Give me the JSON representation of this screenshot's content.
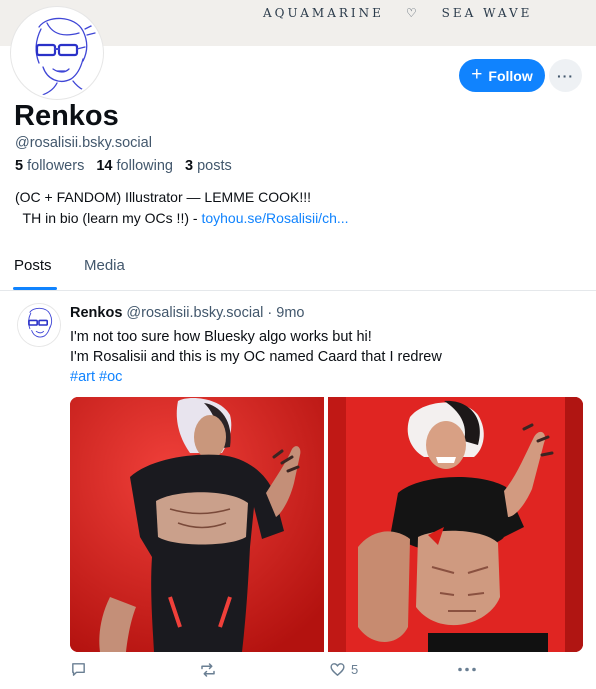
{
  "banner": {
    "left": "AQUAMARINE",
    "right": "SEA WAVE",
    "separator_icon": "heart-outline-icon"
  },
  "profile": {
    "display_name": "Renkos",
    "handle": "@rosalisii.bsky.social",
    "followers_count": "5",
    "followers_label": "followers",
    "following_count": "14",
    "following_label": "following",
    "posts_count": "3",
    "posts_label": "posts",
    "bio_line1": "(OC + FANDOM) Illustrator — LEMME COOK!!!",
    "bio_line2_prefix": "  TH in bio (learn my OCs !!) - ",
    "bio_link": "toyhou.se/Rosalisii/ch..."
  },
  "actions": {
    "follow_label": "Follow",
    "more_label": "···"
  },
  "tabs": [
    {
      "label": "Posts",
      "active": true
    },
    {
      "label": "Media",
      "active": false
    }
  ],
  "post": {
    "author": "Renkos",
    "handle": "@rosalisii.bsky.social",
    "separator": "·",
    "age": "9mo",
    "line1": "I'm not too sure how Bluesky algo works but hi!",
    "line2": "I'm Rosalisii and this is my OC named Caard that I redrew",
    "tags": [
      "#art",
      "#oc"
    ],
    "like_count": "5"
  },
  "colors": {
    "accent": "#1083fe",
    "image_bg": "#d8201f",
    "muted": "#42576c"
  }
}
